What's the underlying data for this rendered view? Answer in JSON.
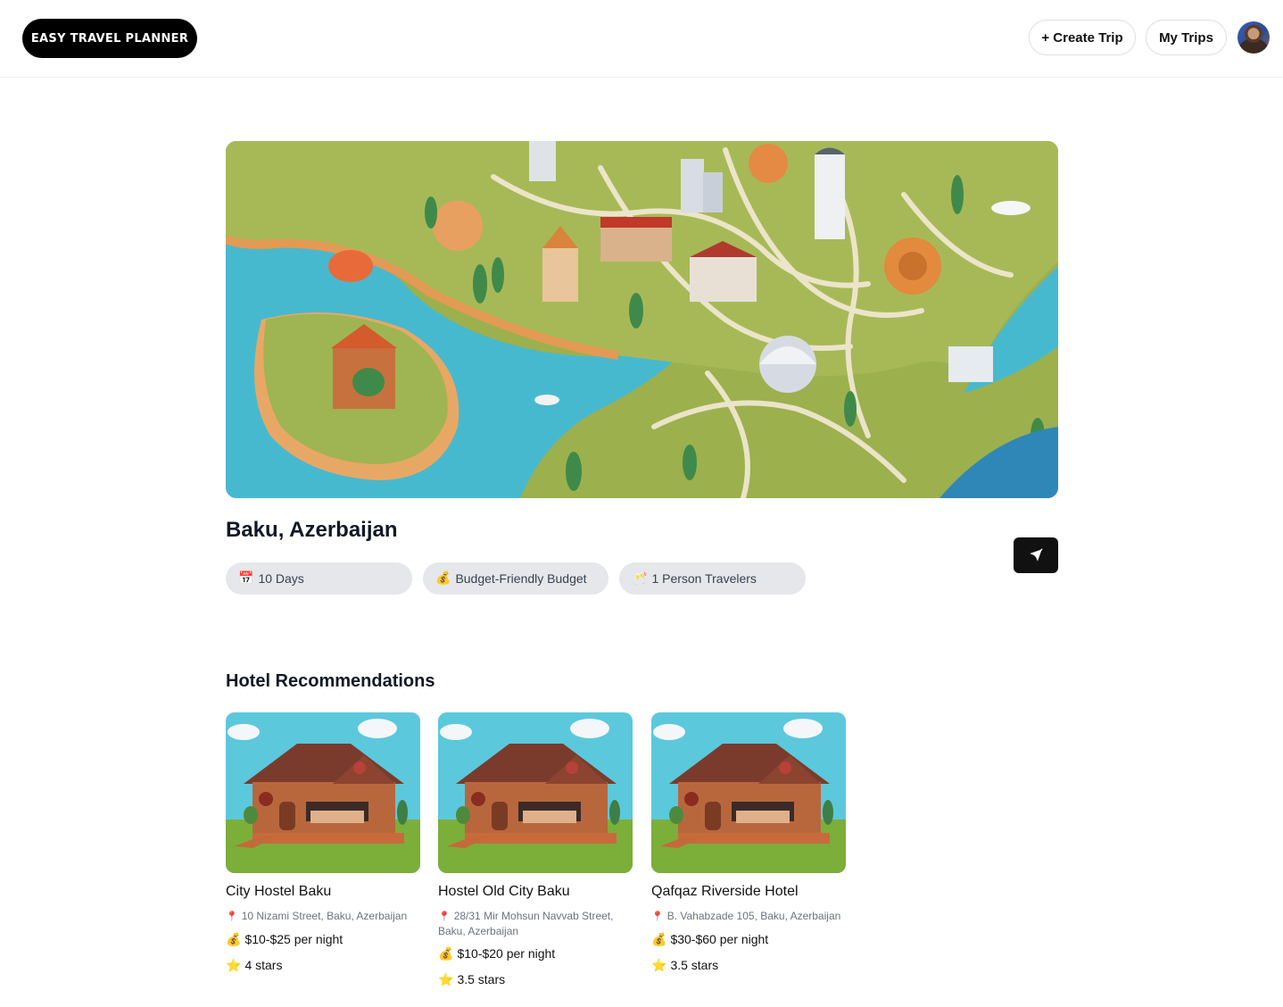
{
  "header": {
    "logo_text": "EASY TRAVEL PLANNER",
    "create_trip_label": "+ Create Trip",
    "my_trips_label": "My Trips"
  },
  "trip": {
    "destination": "Baku, Azerbaijan",
    "chips": {
      "days_icon": "📅",
      "days": "10 Days",
      "budget_icon": "💰",
      "budget": "Budget-Friendly Budget",
      "travelers_icon": "🥂",
      "travelers": "1 Person Travelers"
    }
  },
  "hotels": {
    "title": "Hotel Recommendations",
    "items": [
      {
        "name": "City Hostel Baku",
        "address": "10 Nizami Street, Baku, Azerbaijan",
        "price": "$10-$25 per night",
        "rating": "4 stars"
      },
      {
        "name": "Hostel Old City Baku",
        "address": "28/31 Mir Mohsun Navvab Street, Baku, Azerbaijan",
        "price": "$10-$20 per night",
        "rating": "3.5 stars"
      },
      {
        "name": "Qafqaz Riverside Hotel",
        "address": "B. Vahabzade 105, Baku, Azerbaijan",
        "price": "$30-$60 per night",
        "rating": "3.5 stars"
      }
    ]
  },
  "icons": {
    "pin": "location-pin-icon",
    "money": "money-bag-icon",
    "star": "star-icon",
    "share": "send-icon"
  },
  "colors": {
    "primary": "#000000",
    "chip_bg": "#e5e7eb"
  }
}
